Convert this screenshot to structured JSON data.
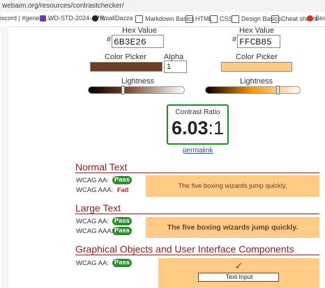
{
  "browser": {
    "url": "webaim.org/resources/contrastchecker/",
    "bookmarks": [
      "iscord | #general...",
      "WD-STD-2024-APR...",
      "smallDazza",
      "Markdown Basics",
      "HTML",
      "CSS",
      "Design Basics",
      "Cheat sheets",
      "Beautiful F"
    ]
  },
  "foreground": {
    "hex_label": "Hex Value",
    "hash": "#",
    "hex": "6B3E26",
    "picker_label": "Color Picker",
    "alpha_label": "Alpha",
    "alpha": "1",
    "lightness_label": "Lightness",
    "lightness_level": 0.36,
    "color": "#6B3E26"
  },
  "background": {
    "hex_label": "Hex Value",
    "hash": "#",
    "hex": "FFCB85",
    "picker_label": "Color Picker",
    "lightness_label": "Lightness",
    "lightness_level": 0.76,
    "color": "#FFCB85"
  },
  "contrast": {
    "label": "Contrast Ratio",
    "value": "6.03",
    "suffix": ":1",
    "permalink": "permalink",
    "accent": "#1f8a1f"
  },
  "normal_text": {
    "title": "Normal Text",
    "aa_label": "WCAG AA:",
    "aa_result": "Pass",
    "aaa_label": "WCAG AAA:",
    "aaa_result": "Fail",
    "sample": "The five boxing wizards jump quickly."
  },
  "large_text": {
    "title": "Large Text",
    "aa_label": "WCAG AA:",
    "aa_result": "Pass",
    "aaa_label": "WCAG AAA:",
    "aaa_result": "Pass",
    "sample": "The five boxing wizards jump quickly."
  },
  "graphical": {
    "title": "Graphical Objects and User Interface Components",
    "aa_label": "WCAG AA:",
    "aa_result": "Pass",
    "checkmark": "✓",
    "input_value": "Text Input"
  },
  "colors": {
    "pass": "#2e8b2e",
    "fail": "#c21a1a",
    "heading": "#8b1a1a"
  }
}
